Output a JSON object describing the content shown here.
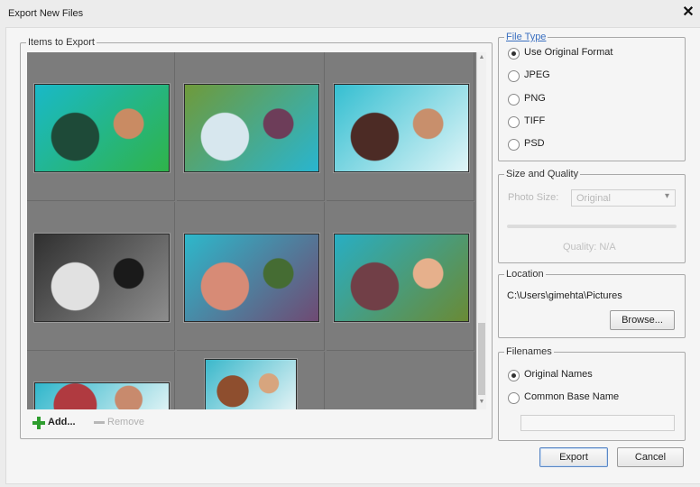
{
  "window": {
    "title": "Export New Files",
    "close_glyph": "✕"
  },
  "items_group": {
    "legend": "Items to Export"
  },
  "thumbnails": [
    {
      "colors": [
        "#19b9c8",
        "#2fb34a",
        "#1e4a38",
        "#c98b63"
      ]
    },
    {
      "colors": [
        "#6f9a3a",
        "#29b5cf",
        "#d7e7ee",
        "#6d3d59"
      ]
    },
    {
      "colors": [
        "#35bfd1",
        "#e0f5f8",
        "#4c2b25",
        "#c88f6c"
      ]
    },
    {
      "colors": [
        "#303030",
        "#8d8d8d",
        "#e1e1e1",
        "#1a1a1a"
      ]
    },
    {
      "colors": [
        "#2db8cb",
        "#6f4a73",
        "#d78b76",
        "#456c33"
      ]
    },
    {
      "colors": [
        "#28aec3",
        "#6a8a35",
        "#713f47",
        "#e6b08c"
      ]
    },
    {
      "colors": [
        "#2fb6cb",
        "#e9f6f7",
        "#b03a40",
        "#c88a6d"
      ]
    },
    {
      "colors": [
        "#3bb8cb",
        "#e7f4f6",
        "#8e4e2e",
        "#d7a57e"
      ]
    }
  ],
  "toolbar": {
    "add_label": "Add...",
    "remove_label": "Remove"
  },
  "file_type": {
    "legend": "File Type",
    "options": [
      "Use Original Format",
      "JPEG",
      "PNG",
      "TIFF",
      "PSD"
    ],
    "selected": "Use Original Format"
  },
  "size_quality": {
    "legend": "Size and Quality",
    "photo_size_label": "Photo Size:",
    "photo_size_value": "Original",
    "quality_label": "Quality: N/A"
  },
  "location": {
    "legend": "Location",
    "path": "C:\\Users\\gimehta\\Pictures",
    "browse_label": "Browse..."
  },
  "filenames": {
    "legend": "Filenames",
    "options": [
      "Original Names",
      "Common Base Name"
    ],
    "selected": "Original Names",
    "base_name_value": ""
  },
  "buttons": {
    "export_label": "Export",
    "cancel_label": "Cancel"
  }
}
